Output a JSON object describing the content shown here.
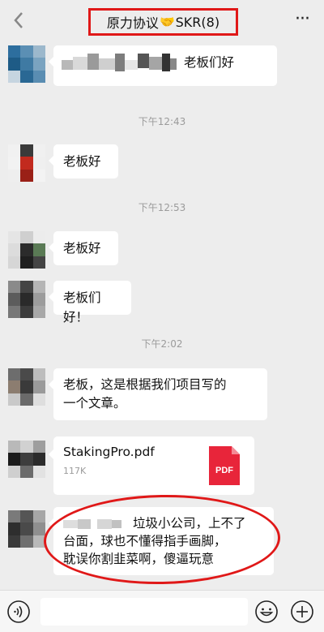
{
  "header": {
    "title_pre": "原力协议",
    "title_emoji": "🤝",
    "title_post": "SKR(8)",
    "more": "···"
  },
  "messages": {
    "m1": "老板们好",
    "t1": "下午12:43",
    "m2": "老板好",
    "t2": "下午12:53",
    "m3": "老板好",
    "m4": "老板们好！",
    "t3": "下午2:02",
    "m5_line1": "老板，这是根据我们项目写的",
    "m5_line2": "一个文章。",
    "file": {
      "name": "StakingPro.pdf",
      "size": "117K",
      "type_label": "PDF"
    },
    "m6_line1": "垃圾小公司，上不了",
    "m6_line2": "台面，球也不懂得指手画脚，",
    "m6_line3": "耽误你割韭菜啊，傻逼玩意"
  },
  "colors": {
    "annotation": "#e01818",
    "pdf": "#e8253a",
    "bubble": "#ffffff",
    "background": "#ededed"
  },
  "icons": [
    "back-chevron-icon",
    "more-icon",
    "pdf-file-icon",
    "voice-icon",
    "emoji-icon",
    "plus-icon"
  ]
}
